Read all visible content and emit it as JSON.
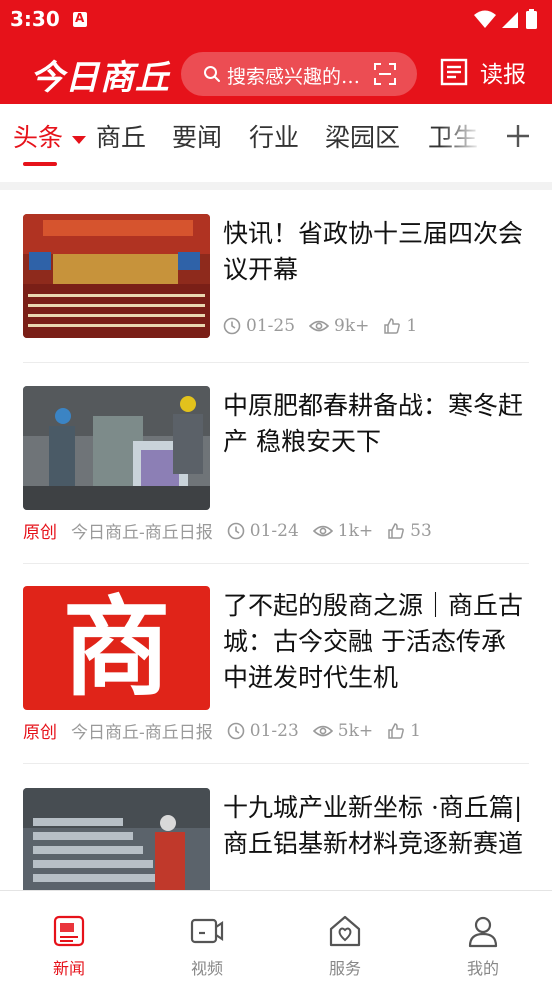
{
  "status_bar": {
    "time": "3:30"
  },
  "header": {
    "logo": "今日商丘",
    "search_placeholder": "搜索感兴趣的…",
    "read_label": "读报"
  },
  "tabs": [
    "头条",
    "商丘",
    "要闻",
    "行业",
    "梁园区",
    "卫生"
  ],
  "articles": [
    {
      "title": "快讯！省政协十三届四次会议开幕",
      "badge": "",
      "source": "",
      "date": "01-25",
      "views": "9k+",
      "likes": "1",
      "thumb": "conference-hall-photo"
    },
    {
      "title": "中原肥都春耕备战：寒冬赶产  稳粮安天下",
      "badge": "原创",
      "source": "今日商丘-商丘日报",
      "date": "01-24",
      "views": "1k+",
      "likes": "53",
      "thumb": "factory-workers-photo"
    },
    {
      "title": "了不起的殷商之源｜商丘古城：古今交融  于活态传承中迸发时代生机",
      "badge": "原创",
      "source": "今日商丘-商丘日报",
      "date": "01-23",
      "views": "5k+",
      "likes": "1",
      "thumb": "shang-character-logo",
      "thumb_glyph": "商"
    },
    {
      "title": "十九城产业新坐标  ·商丘篇|商丘铝基新材料竞逐新赛道",
      "badge": "",
      "source": "",
      "date": "",
      "views": "",
      "likes": "",
      "thumb": "aluminum-factory-photo"
    }
  ],
  "bottom_nav": [
    {
      "label": "新闻",
      "icon": "news-icon",
      "active": true
    },
    {
      "label": "视频",
      "icon": "video-icon",
      "active": false
    },
    {
      "label": "服务",
      "icon": "service-icon",
      "active": false
    },
    {
      "label": "我的",
      "icon": "profile-icon",
      "active": false
    }
  ],
  "colors": {
    "brand": "#e6121a",
    "meta": "#9a9a9a",
    "text": "#111111"
  }
}
